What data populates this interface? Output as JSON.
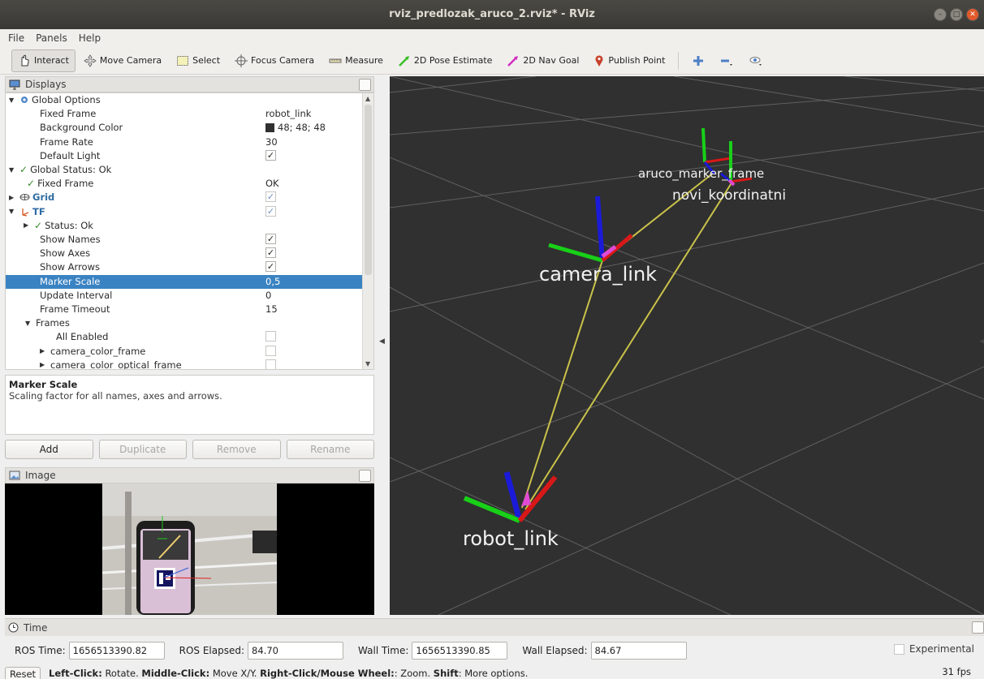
{
  "window": {
    "title": "rviz_predlozak_aruco_2.rviz* - RViz"
  },
  "menu": [
    "File",
    "Panels",
    "Help"
  ],
  "toolbar": {
    "interact": "Interact",
    "move_camera": "Move Camera",
    "select": "Select",
    "focus_camera": "Focus Camera",
    "measure": "Measure",
    "pose_estimate": "2D Pose Estimate",
    "nav_goal": "2D Nav Goal",
    "publish_point": "Publish Point"
  },
  "displays": {
    "title": "Displays",
    "rows": [
      {
        "label": "Global Options"
      },
      {
        "label": "Fixed Frame",
        "value": "robot_link"
      },
      {
        "label": "Background Color",
        "value": "48; 48; 48"
      },
      {
        "label": "Frame Rate",
        "value": "30"
      },
      {
        "label": "Default Light"
      },
      {
        "label": "Global Status: Ok"
      },
      {
        "label": "Fixed Frame",
        "value": "OK"
      },
      {
        "label": "Grid"
      },
      {
        "label": "TF"
      },
      {
        "label": "Status: Ok"
      },
      {
        "label": "Show Names"
      },
      {
        "label": "Show Axes"
      },
      {
        "label": "Show Arrows"
      },
      {
        "label": "Marker Scale",
        "value": "0,5"
      },
      {
        "label": "Update Interval",
        "value": "0"
      },
      {
        "label": "Frame Timeout",
        "value": "15"
      },
      {
        "label": "Frames"
      },
      {
        "label": "All Enabled"
      },
      {
        "label": "camera_color_frame"
      },
      {
        "label": "camera_color_optical_frame"
      }
    ],
    "background_color": "#303030"
  },
  "description": {
    "title": "Marker Scale",
    "text": "Scaling factor for all names, axes and arrows."
  },
  "buttons": {
    "add": "Add",
    "duplicate": "Duplicate",
    "remove": "Remove",
    "rename": "Rename"
  },
  "image_panel": {
    "title": "Image"
  },
  "scene": {
    "labels": {
      "aruco": "aruco_marker_frame",
      "novi": "novi_koordinatni",
      "camera": "camera_link",
      "robot": "robot_link"
    }
  },
  "time": {
    "title": "Time",
    "ros_time_label": "ROS Time:",
    "ros_time": "1656513390.82",
    "ros_elapsed_label": "ROS Elapsed:",
    "ros_elapsed": "84.70",
    "wall_time_label": "Wall Time:",
    "wall_time": "1656513390.85",
    "wall_elapsed_label": "Wall Elapsed:",
    "wall_elapsed": "84.67",
    "experimental": "Experimental"
  },
  "status": {
    "reset": "Reset",
    "hint_left": "Left-Click:",
    "hint_left_txt": " Rotate. ",
    "hint_middle": "Middle-Click:",
    "hint_middle_txt": " Move X/Y. ",
    "hint_right": "Right-Click/Mouse Wheel:",
    "hint_right_txt": ": Zoom. ",
    "hint_shift": "Shift",
    "hint_shift_txt": ": More options.",
    "fps": "31 fps"
  }
}
